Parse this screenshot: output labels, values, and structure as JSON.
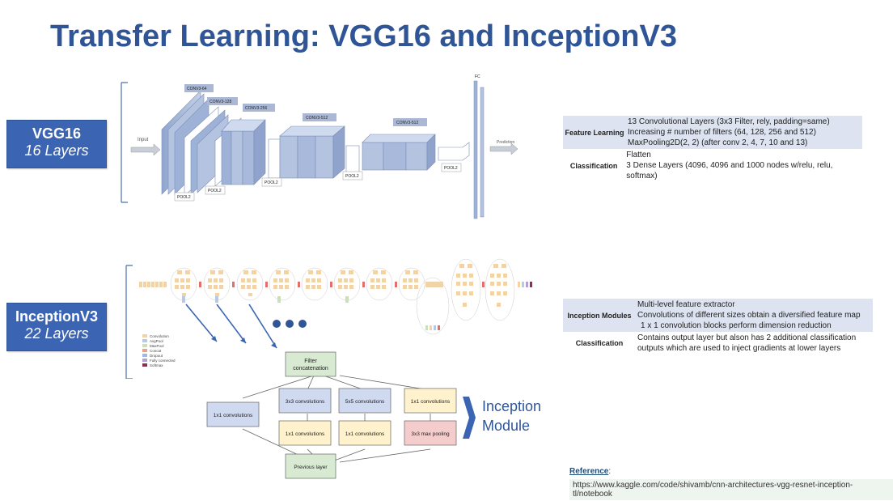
{
  "title": "Transfer Learning: VGG16 and InceptionV3",
  "vgg": {
    "name": "VGG16",
    "layers": "16 Layers",
    "diagram": {
      "input": "Input",
      "output": "Prediction",
      "fc": "FC",
      "conv_labels": [
        "CONV3-64",
        "CONV3-128",
        "CONV3-256",
        "CONV3-512",
        "CONV3-512"
      ],
      "pool_labels": [
        "POOL2",
        "POOL2",
        "POOL2",
        "POOL2",
        "POOL2"
      ]
    },
    "table": {
      "rows": [
        {
          "header": "Feature Learning",
          "lines": [
            "13 Convolutional Layers (3x3 Filter, rely, padding=same)",
            "Increasing # number of filters (64, 128, 256 and 512)",
            "MaxPooling2D(2, 2) (after conv 2, 4, 7, 10 and 13)"
          ]
        },
        {
          "header": "Classification",
          "lines": [
            "Flatten",
            "3 Dense Layers (4096, 4096 and 1000 nodes w/relu, relu, softmax)"
          ]
        }
      ]
    }
  },
  "inception": {
    "name": "InceptionV3",
    "layers": "22 Layers",
    "legend": [
      "Convolution",
      "AvgPool",
      "MaxPool",
      "Concat",
      "Dropout",
      "Fully connected",
      "Softmax"
    ],
    "module": {
      "filter_concat": "Filter concatenation",
      "conv3": "3x3 convolutions",
      "conv5": "5x5 convolutions",
      "conv1_top": "1x1 convolutions",
      "conv1_left": "1x1 convolutions",
      "conv1_a": "1x1 convolutions",
      "conv1_b": "1x1 convolutions",
      "maxpool": "3x3 max pooling",
      "previous": "Previous layer"
    },
    "module_title_line1": "Inception",
    "module_title_line2": "Module",
    "table": {
      "rows": [
        {
          "header": "Inception Modules",
          "lines": [
            "Multi-level feature extractor",
            "Convolutions of different sizes obtain a diversified feature map",
            "1 x 1 convolution blocks perform dimension reduction"
          ]
        },
        {
          "header": "Classification",
          "lines": [
            "Contains output layer but alson has 2 additional classification",
            "outputs which are used to inject gradients at lower layers"
          ]
        }
      ]
    }
  },
  "reference": {
    "label": "Reference",
    "colon": ":",
    "url": "https://www.kaggle.com/code/shivamb/cnn-architectures-vgg-resnet-inception-tl/notebook"
  }
}
